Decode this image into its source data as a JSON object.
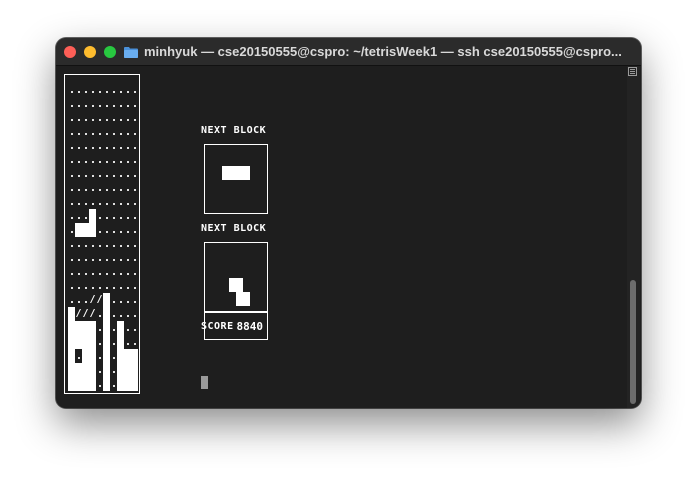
{
  "window": {
    "title": "minhyuk — cse20150555@cspro: ~/tetrisWeek1 — ssh cse20150555@cspro..."
  },
  "board": {
    "rows": [
      "..........",
      "..........",
      "..........",
      "..........",
      "..........",
      "..........",
      "..........",
      "..........",
      "..........",
      "...#......",
      ".###......",
      "..........",
      "..........",
      "..........",
      "..........",
      "...//#....",
      "#///.#....",
      "####.#.#..",
      "####.#.#..",
      "#.##.#.###",
      "####.#.###",
      "####.#.###"
    ]
  },
  "next_block_1": {
    "label": "NEXT BLOCK"
  },
  "next_block_2": {
    "label": "NEXT BLOCK"
  },
  "score": {
    "label": "SCORE",
    "value": "8840"
  },
  "colors": {
    "terminal_bg": "#1e1e1e",
    "titlebar_bg": "#2b2b2b",
    "foreground": "#ffffff",
    "close": "#fe5f57",
    "minimize": "#febc2e",
    "maximize": "#28c840"
  }
}
